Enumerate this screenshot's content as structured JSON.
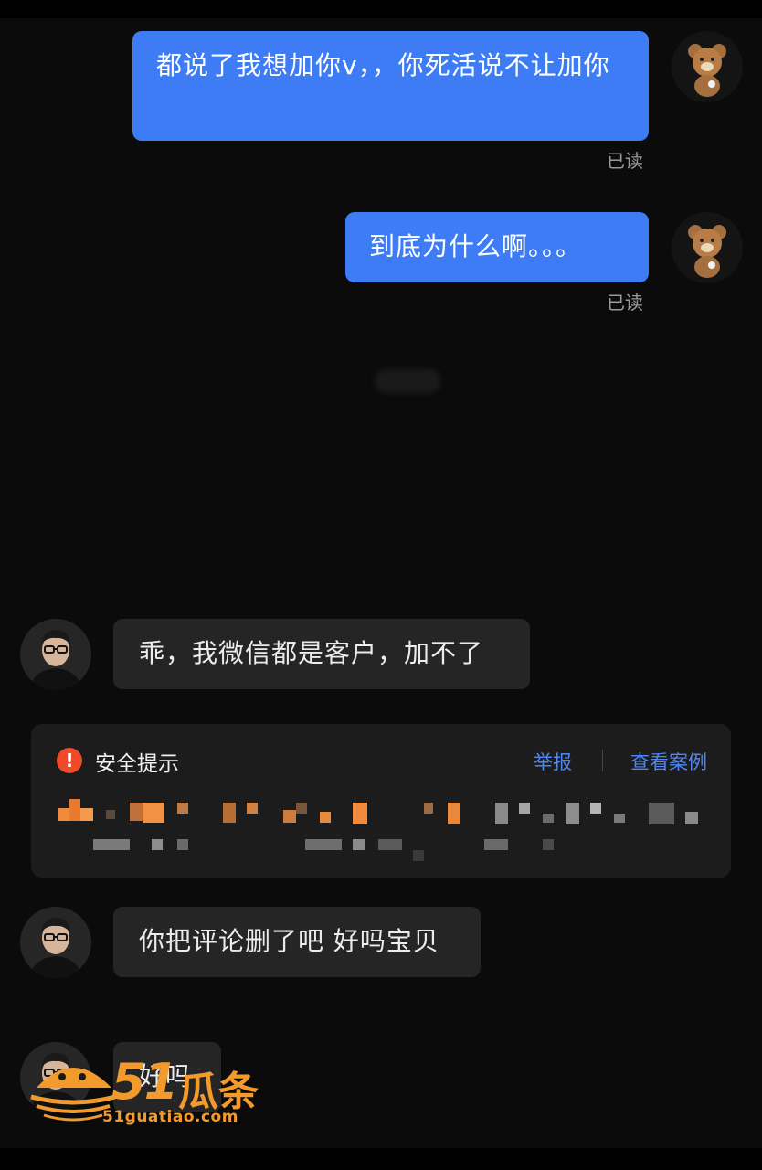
{
  "messages": [
    {
      "from": "me",
      "text": "都说了我想加你v，，你死活说不让加你",
      "status": "已读"
    },
    {
      "from": "me",
      "text": "到底为什么啊。。。",
      "status": "已读"
    },
    {
      "from": "them",
      "text": "乖，我微信都是客户，加不了"
    },
    {
      "from": "them",
      "text": "你把评论删了吧 好吗宝贝"
    },
    {
      "from": "them",
      "text": "好吗"
    }
  ],
  "safety_notice": {
    "title": "安全提示",
    "report_label": "举报",
    "view_cases_label": "查看案例"
  },
  "watermark": {
    "brand_number": "51",
    "brand_name": "瓜条",
    "url": "51guatiao.com"
  },
  "colors": {
    "background": "#0b0b0b",
    "my_bubble": "#3d7cf5",
    "their_bubble": "#252525",
    "link_blue": "#4e86f2",
    "warning_red": "#ee4b2b",
    "watermark_orange": "#f39a2d"
  },
  "icons": {
    "my_avatar": "teddy-bear-avatar",
    "their_avatar": "man-with-glasses-avatar",
    "warning": "exclamation-circle-icon"
  }
}
